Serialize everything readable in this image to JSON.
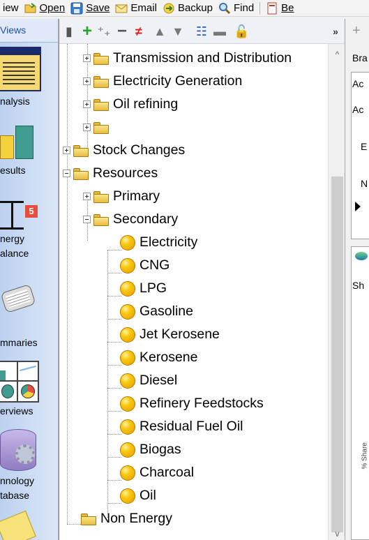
{
  "toolbar": {
    "items": [
      {
        "label": "iew",
        "icon": "view-icon"
      },
      {
        "label": "Open",
        "icon": "open-folder-icon"
      },
      {
        "label": "Save",
        "icon": "save-icon"
      },
      {
        "label": "Email",
        "icon": "email-icon"
      },
      {
        "label": "Backup",
        "icon": "backup-icon"
      },
      {
        "label": "Find",
        "icon": "search-icon"
      },
      {
        "label": "Be",
        "icon": "book-icon"
      }
    ]
  },
  "sidebar": {
    "header": "Views",
    "items": [
      {
        "label_lines": [
          "nalysis"
        ],
        "icon": "analysis-icon"
      },
      {
        "label_lines": [
          "esults"
        ],
        "icon": "results-chart-icon"
      },
      {
        "label_lines": [
          "nergy",
          "alance"
        ],
        "icon": "energy-balance-icon"
      },
      {
        "label_lines": [
          "mmaries"
        ],
        "icon": "summaries-icon"
      },
      {
        "label_lines": [
          "erviews"
        ],
        "icon": "overviews-icon"
      },
      {
        "label_lines": [
          "nnology",
          "tabase"
        ],
        "icon": "technology-database-icon"
      }
    ]
  },
  "tree_toolbar": {
    "icons": [
      "folder-add-icon",
      "add-icon",
      "add-multiple-icon",
      "remove-icon",
      "remove-red-icon",
      "move-up-icon",
      "move-down-icon",
      "tree-view-icon",
      "folder-icon",
      "lock-icon",
      "more-chevron-icon"
    ]
  },
  "tree": {
    "nodes": [
      {
        "label": "Transmission and Distribution",
        "type": "folder",
        "level": 2,
        "expander": "plus"
      },
      {
        "label": "Electricity Generation",
        "type": "folder",
        "level": 2,
        "expander": "plus"
      },
      {
        "label": "Oil refining",
        "type": "folder",
        "level": 2,
        "expander": "plus"
      },
      {
        "label": "",
        "type": "folder",
        "level": 2,
        "expander": "plus"
      },
      {
        "label": "Stock Changes",
        "type": "folder",
        "level": 1,
        "expander": "plus"
      },
      {
        "label": "Resources",
        "type": "folder",
        "level": 1,
        "expander": "minus"
      },
      {
        "label": "Primary",
        "type": "folder",
        "level": 2,
        "expander": "plus"
      },
      {
        "label": "Secondary",
        "type": "folder",
        "level": 2,
        "expander": "minus"
      },
      {
        "label": "Electricity",
        "type": "fuel",
        "level": 3
      },
      {
        "label": "CNG",
        "type": "fuel",
        "level": 3
      },
      {
        "label": "LPG",
        "type": "fuel",
        "level": 3
      },
      {
        "label": "Gasoline",
        "type": "fuel",
        "level": 3
      },
      {
        "label": "Jet Kerosene",
        "type": "fuel",
        "level": 3
      },
      {
        "label": "Kerosene",
        "type": "fuel",
        "level": 3
      },
      {
        "label": "Diesel",
        "type": "fuel",
        "level": 3
      },
      {
        "label": "Refinery Feedstocks",
        "type": "fuel",
        "level": 3
      },
      {
        "label": "Residual Fuel Oil",
        "type": "fuel",
        "level": 3
      },
      {
        "label": "Biogas",
        "type": "fuel",
        "level": 3
      },
      {
        "label": "Charcoal",
        "type": "fuel",
        "level": 3
      },
      {
        "label": "Oil",
        "type": "fuel",
        "level": 3
      },
      {
        "label": "Non Energy",
        "type": "folder",
        "level": 1,
        "expander": "none"
      }
    ]
  },
  "right_panel": {
    "texts": [
      "Bra",
      "Ac",
      "Ac",
      "E",
      "N",
      "Sh",
      "% Share"
    ]
  }
}
